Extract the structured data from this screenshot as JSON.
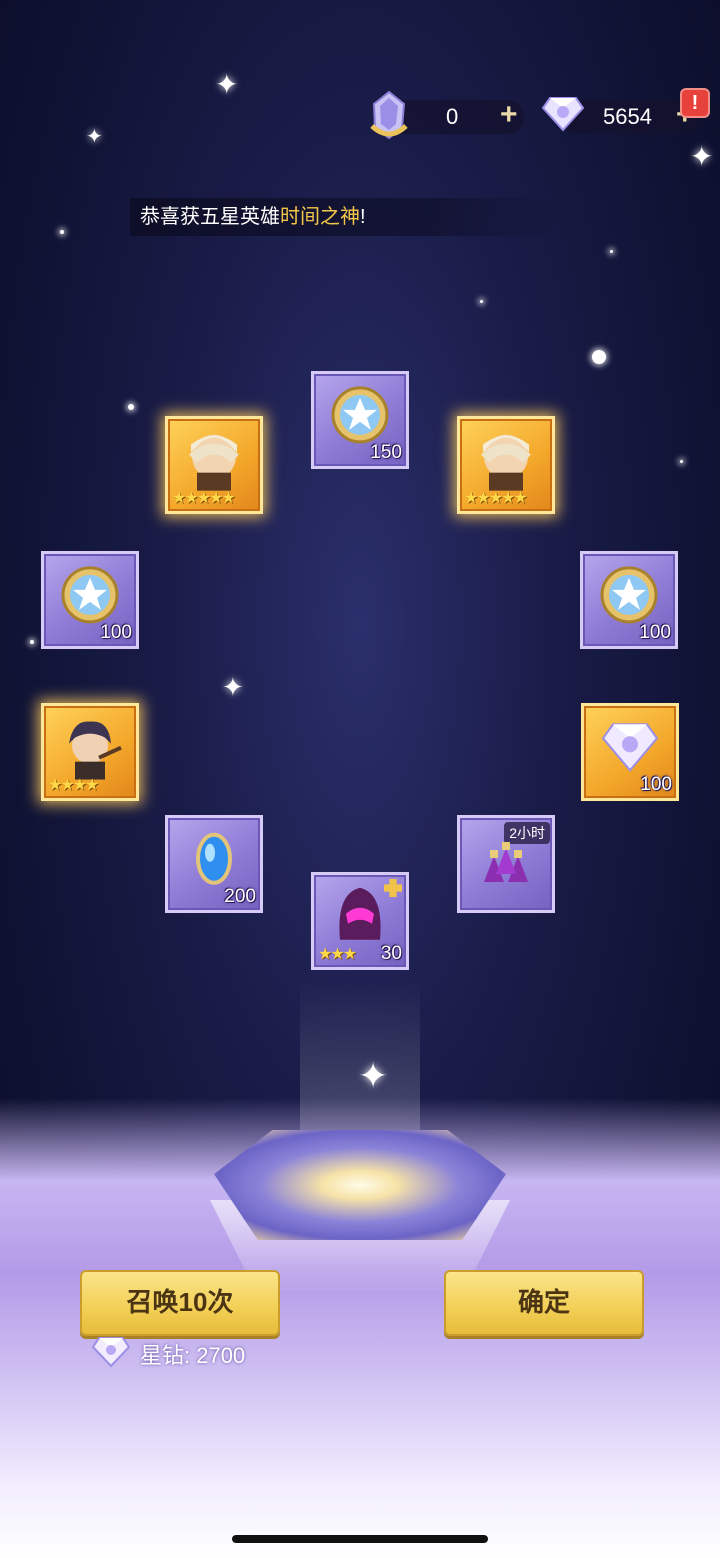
{
  "resources": {
    "crystal_value": "0",
    "diamond_value": "5654",
    "alert": "!"
  },
  "announcement": {
    "prefix": "恭喜获五星英雄",
    "hero_name": "时间之神",
    "suffix": "!"
  },
  "rewards": [
    {
      "kind": "star-medal",
      "quantity": "150",
      "rarity": "purple"
    },
    {
      "kind": "hero-portrait",
      "stars": "★★★★★",
      "rarity": "gold"
    },
    {
      "kind": "hero-portrait",
      "stars": "★★★★★",
      "rarity": "gold"
    },
    {
      "kind": "star-medal",
      "quantity": "100",
      "rarity": "purple"
    },
    {
      "kind": "star-medal",
      "quantity": "100",
      "rarity": "purple"
    },
    {
      "kind": "hero-portrait",
      "stars": "★★★★",
      "rarity": "gold"
    },
    {
      "kind": "diamond",
      "quantity": "100",
      "rarity": "gold"
    },
    {
      "kind": "blue-gem",
      "quantity": "200",
      "rarity": "purple"
    },
    {
      "kind": "potion",
      "tag": "2小时",
      "rarity": "purple"
    },
    {
      "kind": "helmet",
      "stars": "★★★",
      "quantity": "30",
      "rarity": "purple"
    }
  ],
  "buttons": {
    "summon_label": "召唤10次",
    "confirm_label": "确定"
  },
  "cost": {
    "label": "星钻: 2700"
  },
  "colors": {
    "gold": "#f3a72a",
    "purple": "#8e7bd6",
    "highlight": "#f4c74a"
  }
}
